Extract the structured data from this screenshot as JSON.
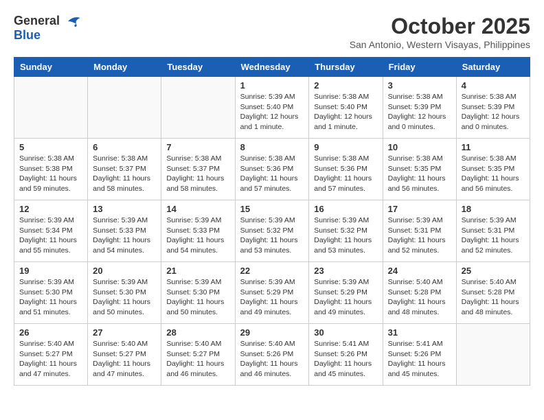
{
  "header": {
    "logo_general": "General",
    "logo_blue": "Blue",
    "month_title": "October 2025",
    "location": "San Antonio, Western Visayas, Philippines"
  },
  "weekdays": [
    "Sunday",
    "Monday",
    "Tuesday",
    "Wednesday",
    "Thursday",
    "Friday",
    "Saturday"
  ],
  "weeks": [
    [
      {
        "day": "",
        "info": ""
      },
      {
        "day": "",
        "info": ""
      },
      {
        "day": "",
        "info": ""
      },
      {
        "day": "1",
        "info": "Sunrise: 5:39 AM\nSunset: 5:40 PM\nDaylight: 12 hours\nand 1 minute."
      },
      {
        "day": "2",
        "info": "Sunrise: 5:38 AM\nSunset: 5:40 PM\nDaylight: 12 hours\nand 1 minute."
      },
      {
        "day": "3",
        "info": "Sunrise: 5:38 AM\nSunset: 5:39 PM\nDaylight: 12 hours\nand 0 minutes."
      },
      {
        "day": "4",
        "info": "Sunrise: 5:38 AM\nSunset: 5:39 PM\nDaylight: 12 hours\nand 0 minutes."
      }
    ],
    [
      {
        "day": "5",
        "info": "Sunrise: 5:38 AM\nSunset: 5:38 PM\nDaylight: 11 hours\nand 59 minutes."
      },
      {
        "day": "6",
        "info": "Sunrise: 5:38 AM\nSunset: 5:37 PM\nDaylight: 11 hours\nand 58 minutes."
      },
      {
        "day": "7",
        "info": "Sunrise: 5:38 AM\nSunset: 5:37 PM\nDaylight: 11 hours\nand 58 minutes."
      },
      {
        "day": "8",
        "info": "Sunrise: 5:38 AM\nSunset: 5:36 PM\nDaylight: 11 hours\nand 57 minutes."
      },
      {
        "day": "9",
        "info": "Sunrise: 5:38 AM\nSunset: 5:36 PM\nDaylight: 11 hours\nand 57 minutes."
      },
      {
        "day": "10",
        "info": "Sunrise: 5:38 AM\nSunset: 5:35 PM\nDaylight: 11 hours\nand 56 minutes."
      },
      {
        "day": "11",
        "info": "Sunrise: 5:38 AM\nSunset: 5:35 PM\nDaylight: 11 hours\nand 56 minutes."
      }
    ],
    [
      {
        "day": "12",
        "info": "Sunrise: 5:39 AM\nSunset: 5:34 PM\nDaylight: 11 hours\nand 55 minutes."
      },
      {
        "day": "13",
        "info": "Sunrise: 5:39 AM\nSunset: 5:33 PM\nDaylight: 11 hours\nand 54 minutes."
      },
      {
        "day": "14",
        "info": "Sunrise: 5:39 AM\nSunset: 5:33 PM\nDaylight: 11 hours\nand 54 minutes."
      },
      {
        "day": "15",
        "info": "Sunrise: 5:39 AM\nSunset: 5:32 PM\nDaylight: 11 hours\nand 53 minutes."
      },
      {
        "day": "16",
        "info": "Sunrise: 5:39 AM\nSunset: 5:32 PM\nDaylight: 11 hours\nand 53 minutes."
      },
      {
        "day": "17",
        "info": "Sunrise: 5:39 AM\nSunset: 5:31 PM\nDaylight: 11 hours\nand 52 minutes."
      },
      {
        "day": "18",
        "info": "Sunrise: 5:39 AM\nSunset: 5:31 PM\nDaylight: 11 hours\nand 52 minutes."
      }
    ],
    [
      {
        "day": "19",
        "info": "Sunrise: 5:39 AM\nSunset: 5:30 PM\nDaylight: 11 hours\nand 51 minutes."
      },
      {
        "day": "20",
        "info": "Sunrise: 5:39 AM\nSunset: 5:30 PM\nDaylight: 11 hours\nand 50 minutes."
      },
      {
        "day": "21",
        "info": "Sunrise: 5:39 AM\nSunset: 5:30 PM\nDaylight: 11 hours\nand 50 minutes."
      },
      {
        "day": "22",
        "info": "Sunrise: 5:39 AM\nSunset: 5:29 PM\nDaylight: 11 hours\nand 49 minutes."
      },
      {
        "day": "23",
        "info": "Sunrise: 5:39 AM\nSunset: 5:29 PM\nDaylight: 11 hours\nand 49 minutes."
      },
      {
        "day": "24",
        "info": "Sunrise: 5:40 AM\nSunset: 5:28 PM\nDaylight: 11 hours\nand 48 minutes."
      },
      {
        "day": "25",
        "info": "Sunrise: 5:40 AM\nSunset: 5:28 PM\nDaylight: 11 hours\nand 48 minutes."
      }
    ],
    [
      {
        "day": "26",
        "info": "Sunrise: 5:40 AM\nSunset: 5:27 PM\nDaylight: 11 hours\nand 47 minutes."
      },
      {
        "day": "27",
        "info": "Sunrise: 5:40 AM\nSunset: 5:27 PM\nDaylight: 11 hours\nand 47 minutes."
      },
      {
        "day": "28",
        "info": "Sunrise: 5:40 AM\nSunset: 5:27 PM\nDaylight: 11 hours\nand 46 minutes."
      },
      {
        "day": "29",
        "info": "Sunrise: 5:40 AM\nSunset: 5:26 PM\nDaylight: 11 hours\nand 46 minutes."
      },
      {
        "day": "30",
        "info": "Sunrise: 5:41 AM\nSunset: 5:26 PM\nDaylight: 11 hours\nand 45 minutes."
      },
      {
        "day": "31",
        "info": "Sunrise: 5:41 AM\nSunset: 5:26 PM\nDaylight: 11 hours\nand 45 minutes."
      },
      {
        "day": "",
        "info": ""
      }
    ]
  ]
}
